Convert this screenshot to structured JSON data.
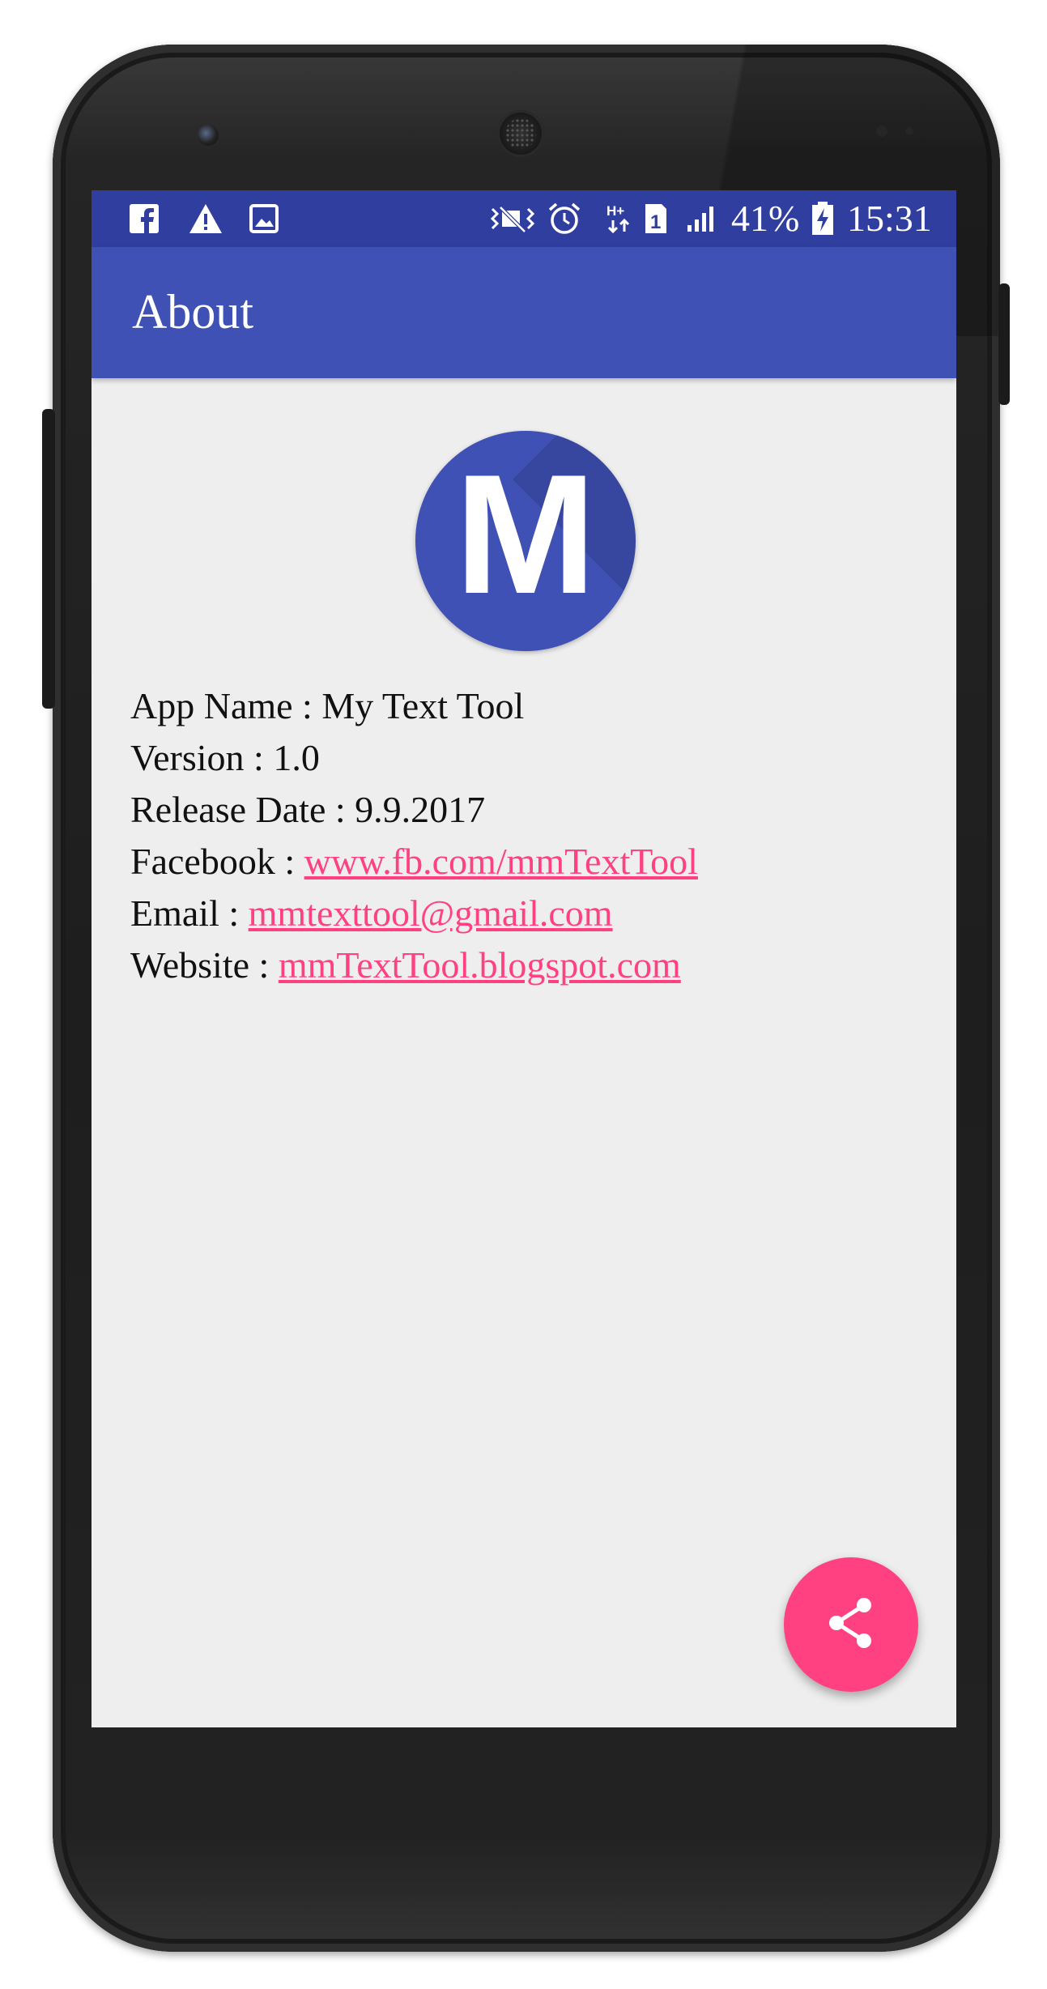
{
  "statusbar": {
    "left_icons": [
      "facebook-icon",
      "warning-icon",
      "image-icon"
    ],
    "right_icons": [
      "vibrate-icon",
      "alarm-icon",
      "hplus-data-icon",
      "sim-1-icon",
      "signal-icon",
      "battery-charging-icon"
    ],
    "battery": "41%",
    "time": "15:31"
  },
  "appbar": {
    "title": "About"
  },
  "logo": {
    "letter": "M",
    "color": "#3f51b5"
  },
  "info": {
    "app_name_label": "App Name : ",
    "app_name_value": "My Text Tool",
    "version_label": "Version : ",
    "version_value": "1.0",
    "release_label": "Release Date : ",
    "release_value": "9.9.2017",
    "facebook_label": "Facebook : ",
    "facebook_link": "www.fb.com/mmTextTool",
    "email_label": "Email : ",
    "email_link": "mmtexttool@gmail.com",
    "website_label": "Website : ",
    "website_link": "mmTextTool.blogspot.com"
  },
  "fab": {
    "icon": "share-icon",
    "color": "#ff4081"
  },
  "colors": {
    "statusbar": "#303f9f",
    "primary": "#3f51b5",
    "accent": "#ff4081",
    "background": "#eeeeee"
  }
}
